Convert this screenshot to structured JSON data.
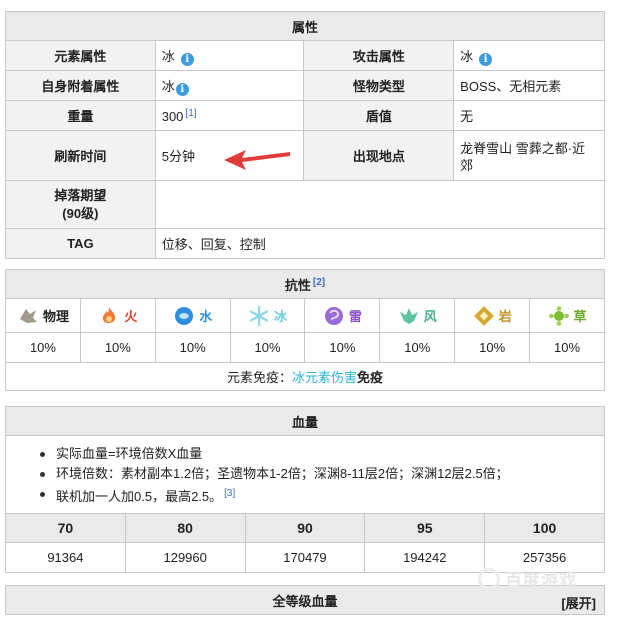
{
  "attributes": {
    "title": "属性",
    "element_label": "元素属性",
    "element_value": "冰",
    "attack_label": "攻击属性",
    "attack_value": "冰",
    "self_attach_label": "自身附着属性",
    "self_attach_value": "冰",
    "monster_type_label": "怪物类型",
    "monster_type_value": "BOSS、无相元素",
    "weight_label": "重量",
    "weight_value": "300",
    "weight_ref": "[1]",
    "shield_label": "盾值",
    "shield_value": "无",
    "refresh_label": "刷新时间",
    "refresh_value": "5分钟",
    "location_label": "出现地点",
    "location_value": "龙脊雪山 雪葬之都·近郊",
    "drop_label": "掉落期望",
    "drop_level": "(90级)",
    "drop_value": "",
    "tag_label": "TAG",
    "tag_value": "位移、回复、控制",
    "info_icon_glyph": "i"
  },
  "resistance": {
    "title": "抗性",
    "ref": "[2]",
    "elements": [
      {
        "name": "物理",
        "icon": "physical-icon",
        "value": "10%",
        "color": "#a39a8c"
      },
      {
        "name": "火",
        "icon": "pyro-icon",
        "value": "10%",
        "color": "#ef7a35"
      },
      {
        "name": "水",
        "icon": "hydro-icon",
        "value": "10%",
        "color": "#2e8fe0"
      },
      {
        "name": "冰",
        "icon": "cryo-icon",
        "value": "10%",
        "color": "#8ad6ea"
      },
      {
        "name": "雷",
        "icon": "electro-icon",
        "value": "10%",
        "color": "#9c6ad6"
      },
      {
        "name": "风",
        "icon": "anemo-icon",
        "value": "10%",
        "color": "#5fc4a0"
      },
      {
        "name": "岩",
        "icon": "geo-icon",
        "value": "10%",
        "color": "#d6a830"
      },
      {
        "name": "草",
        "icon": "dendro-icon",
        "value": "10%",
        "color": "#7cbd32"
      }
    ],
    "immune_prefix": "元素免疫：",
    "immune_highlight": "冰元素伤害",
    "immune_suffix": "免疫"
  },
  "hp": {
    "title": "血量",
    "notes": [
      "实际血量=环境倍数X血量",
      "环境倍数：素材副本1.2倍；圣遗物本1-2倍；深渊8-11层2倍；深渊12层2.5倍；",
      "联机加一人加0.5，最高2.5。"
    ],
    "note_ref": "[3]",
    "levels": [
      "70",
      "80",
      "90",
      "95",
      "100"
    ],
    "values": [
      "91364",
      "129960",
      "170479",
      "194242",
      "257356"
    ]
  },
  "full_hp": {
    "title": "全等级血量",
    "expand_label": "[展开]"
  },
  "watermark": {
    "text": "百度游戏"
  },
  "colors": {
    "header_bg": "#eaeaea",
    "label_bg": "#f2f2f2",
    "border": "#c8c8c8",
    "info_icon": "#3b9be0",
    "annotation_arrow": "#e23b3b",
    "immune_highlight": "#2bb3d9",
    "reference_link": "#3a6cc7"
  }
}
